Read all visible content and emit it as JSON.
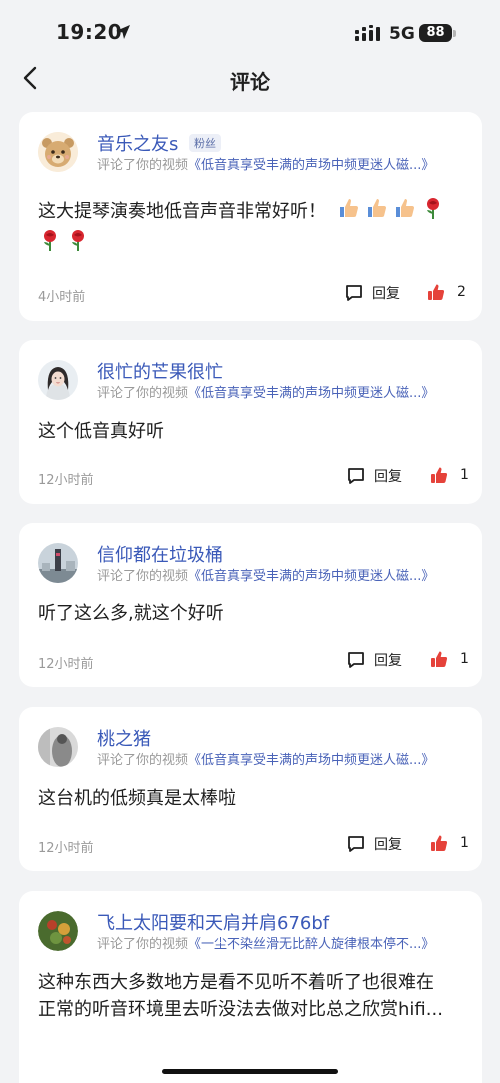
{
  "status_bar": {
    "time": "19:20",
    "network": "5G",
    "battery": "88"
  },
  "header": {
    "title": "评论"
  },
  "comments": [
    {
      "user": "音乐之友s",
      "badge": "粉丝",
      "action_prefix": "评论了你的视频",
      "video_title": "《低音真享受丰满的声场中频更迷人磁...》",
      "text": "这大提琴演奏地低音声音非常好听！",
      "emojis": [
        "thumbs-up",
        "thumbs-up",
        "thumbs-up",
        "rose",
        "rose",
        "rose"
      ],
      "time": "4小时前",
      "reply_label": "回复",
      "likes": "2"
    },
    {
      "user": "很忙的芒果很忙",
      "action_prefix": "评论了你的视频",
      "video_title": "《低音真享受丰满的声场中频更迷人磁...》",
      "text": "这个低音真好听",
      "time": "12小时前",
      "reply_label": "回复",
      "likes": "1"
    },
    {
      "user": "信仰都在垃圾桶",
      "action_prefix": "评论了你的视频",
      "video_title": "《低音真享受丰满的声场中频更迷人磁...》",
      "text": "听了这么多,就这个好听",
      "time": "12小时前",
      "reply_label": "回复",
      "likes": "1"
    },
    {
      "user": "桃之猪",
      "action_prefix": "评论了你的视频",
      "video_title": "《低音真享受丰满的声场中频更迷人磁...》",
      "text": "这台机的低频真是太棒啦",
      "time": "12小时前",
      "reply_label": "回复",
      "likes": "1"
    },
    {
      "user": "飞上太阳要和天肩并肩676bf",
      "action_prefix": "评论了你的视频",
      "video_title": "《一尘不染丝滑无比醉人旋律根本停不...》",
      "text_line1": "这种东西大多数地方是看不见听不着听了也很难在",
      "text_line2": "正常的听音环境里去听没法去做对比总之欣赏hifi..."
    }
  ]
}
